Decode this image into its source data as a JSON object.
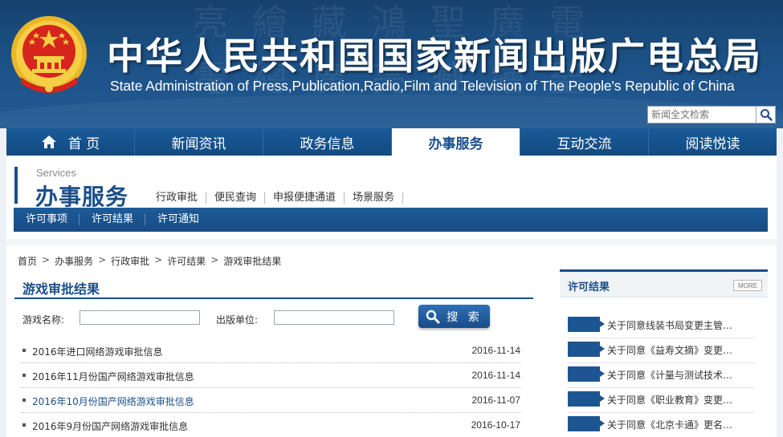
{
  "header": {
    "title": "中华人民共和国国家新闻出版广电总局",
    "subtitle": "State Administration of Press,Publication,Radio,Film and Television of The People's Republic of China",
    "search_placeholder": "新闻全文检索",
    "search_icon": "magnifier-icon",
    "emblem_icon": "national-emblem-icon"
  },
  "nav": {
    "items": [
      {
        "label": "首 页",
        "icon": "home-icon"
      },
      {
        "label": "新闻资讯"
      },
      {
        "label": "政务信息"
      },
      {
        "label": "办事服务",
        "active": true
      },
      {
        "label": "互动交流"
      },
      {
        "label": "阅读悦读"
      }
    ]
  },
  "section": {
    "en": "Services",
    "cn": "办事服务",
    "subnav": [
      "行政审批",
      "便民查询",
      "申报便捷通道",
      "场景服务"
    ],
    "bar": [
      "许可事项",
      "许可结果",
      "许可通知"
    ]
  },
  "breadcrumb": [
    "首页",
    "办事服务",
    "行政审批",
    "许可结果",
    "游戏审批结果"
  ],
  "breadcrumb_sep": ">",
  "list": {
    "title": "游戏审批结果",
    "filter": {
      "name_label": "游戏名称:",
      "publisher_label": "出版单位:",
      "search_label": "搜 索"
    },
    "items": [
      {
        "title": "2016年进口网络游戏审批信息",
        "date": "2016-11-14"
      },
      {
        "title": "2016年11月份国产网络游戏审批信息",
        "date": "2016-11-14"
      },
      {
        "title": "2016年10月份国产网络游戏审批信息",
        "date": "2016-11-07",
        "highlight": true
      },
      {
        "title": "2016年9月份国产网络游戏审批信息",
        "date": "2016-10-17"
      }
    ]
  },
  "sidebar": {
    "title": "许可结果",
    "more": "MORE",
    "items": [
      "关于同意线装书局变更主管…",
      "关于同意《益寿文摘》变更…",
      "关于同意《计量与测试技术…",
      "关于同意《职业教育》变更…",
      "关于同意《北京卡通》更名…"
    ]
  },
  "colors": {
    "primary": "#1b4f8a",
    "banner": "#1c5186",
    "emblem_red": "#d6251d",
    "emblem_gold": "#f2c230"
  }
}
